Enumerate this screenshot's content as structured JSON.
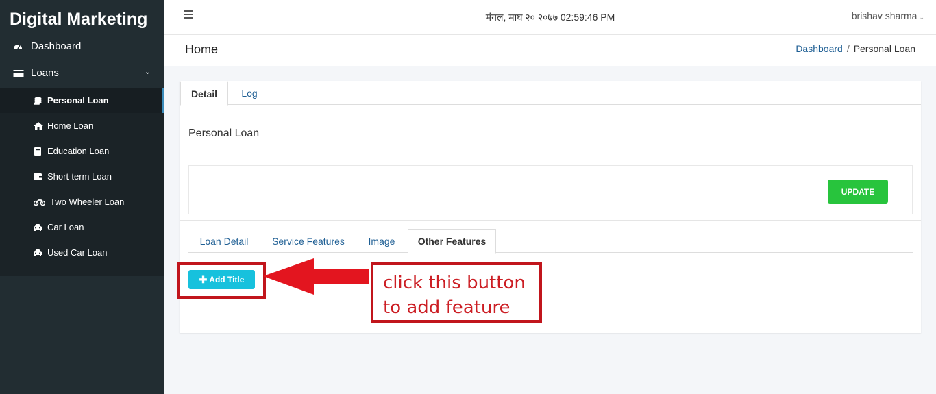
{
  "app": {
    "brand": "Digital Marketing"
  },
  "sidebar": {
    "items": [
      {
        "label": "Dashboard",
        "icon": "speedometer-icon"
      },
      {
        "label": "Loans",
        "icon": "card-icon"
      }
    ],
    "loans_sub": [
      {
        "label": "Personal Loan",
        "icon": "coins-icon",
        "active": true
      },
      {
        "label": "Home Loan",
        "icon": "home-icon"
      },
      {
        "label": "Education Loan",
        "icon": "book-icon"
      },
      {
        "label": "Short-term Loan",
        "icon": "wallet-icon"
      },
      {
        "label": "Two Wheeler Loan",
        "icon": "motorcycle-icon"
      },
      {
        "label": "Car Loan",
        "icon": "car-icon"
      },
      {
        "label": "Used Car Loan",
        "icon": "car-icon"
      }
    ]
  },
  "header": {
    "datetime": "मंगल, माघ २० २०७७ 02:59:46 PM",
    "user": "brishav sharma"
  },
  "page": {
    "title": "Home",
    "breadcrumb": {
      "link": "Dashboard",
      "current": "Personal Loan"
    }
  },
  "card": {
    "tabs": [
      "Detail",
      "Log"
    ],
    "title": "Personal Loan",
    "update_label": "UPDATE",
    "subtabs": [
      "Loan Detail",
      "Service Features",
      "Image",
      "Other Features"
    ],
    "add_label": "Add Title"
  },
  "annotation": {
    "text": "click this button to add feature",
    "color": "#c1151c"
  },
  "colors": {
    "sidebar": "#222d32",
    "update": "#28c43d",
    "add": "#17c1dd",
    "link": "#1f5f94"
  }
}
